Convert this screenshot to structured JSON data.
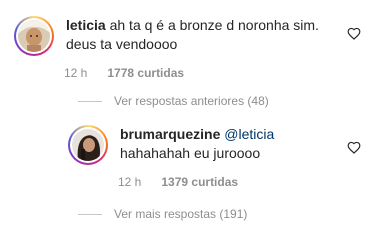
{
  "comment1": {
    "username": "leticia",
    "text_line1": "ah ta q é a bronze d noronha sim.",
    "text_line2": "deus ta vendoooo",
    "time": "12 h",
    "likes": "1778 curtidas"
  },
  "view_previous": "Ver respostas anteriores (48)",
  "reply": {
    "username": "brumarquezine",
    "mention": "@leticia",
    "text": "hahahahah eu juroooo",
    "time": "12 h",
    "likes": "1379 curtidas"
  },
  "view_more": "Ver mais respostas (191)",
  "icons": {
    "like": "heart-outline-icon"
  }
}
